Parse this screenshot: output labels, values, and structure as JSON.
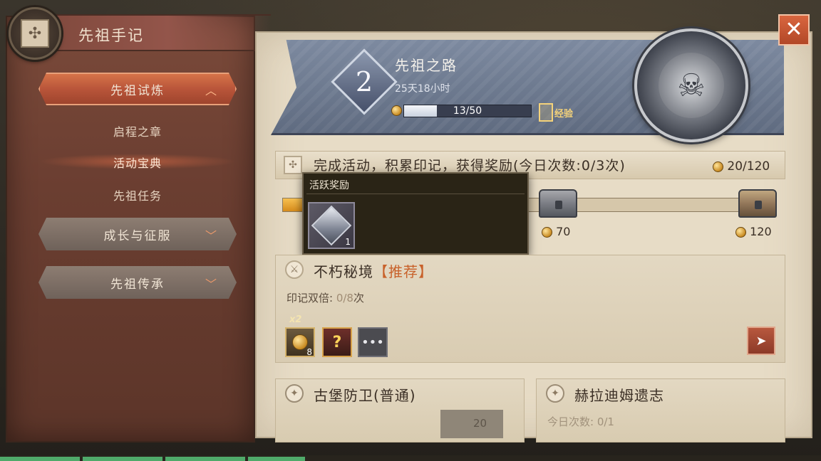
{
  "sidebar": {
    "title": "先祖手记",
    "emblem_icon": "rune-emblem-icon",
    "sections": [
      {
        "label": "先祖试炼",
        "state": "expanded"
      },
      {
        "label": "成长与征服",
        "state": "collapsed"
      },
      {
        "label": "先祖传承",
        "state": "collapsed"
      }
    ],
    "sub_items": [
      "启程之章",
      "活动宝典",
      "先祖任务"
    ],
    "selected_sub_item": "活动宝典"
  },
  "header": {
    "rank": "2",
    "title": "先祖之路",
    "time_left": "25天18小时",
    "xp_label": "13/50",
    "xp_progress": 0.26,
    "boost_label": "经验"
  },
  "activity": {
    "description": "完成活动，积累印记，获得奖励(今日次数:0/3次)",
    "total": "20/120",
    "progress": 0.167,
    "milestones": [
      "70",
      "120"
    ]
  },
  "tooltip": {
    "title": "活跃奖励",
    "item_icon": "silver-gem-icon",
    "item_count": "1"
  },
  "dungeon": {
    "name": "不朽秘境",
    "tag": "【推荐】",
    "double_label": "印记双倍: ",
    "double_count": "0/8",
    "double_unit": "次",
    "multiplier": "x2",
    "rewards": [
      {
        "icon": "coin-orb-icon",
        "count": "8"
      },
      {
        "icon": "mystery-icon",
        "glyph": "?"
      },
      {
        "icon": "more-icon",
        "glyph": "•••"
      }
    ]
  },
  "cards": [
    {
      "name": "古堡防卫(普通)",
      "faded_value": "20"
    },
    {
      "name": "赫拉迪姆遗志",
      "faded_value": "今日次数: 0/1"
    }
  ],
  "colors": {
    "accent": "#c8612a",
    "close_button": "#d9663f",
    "progress_fill": "#f7c050"
  }
}
